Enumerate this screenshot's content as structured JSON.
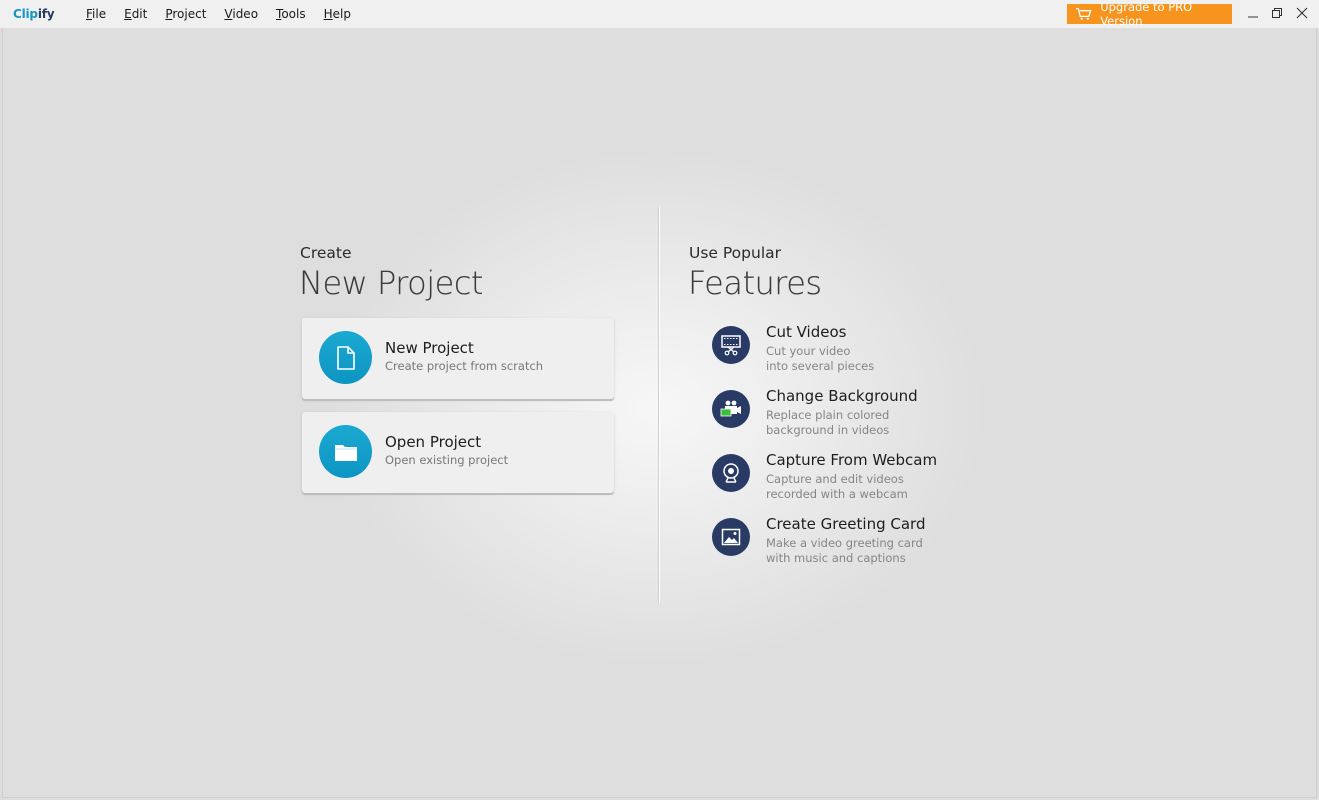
{
  "app": {
    "logo_part1": "Clip",
    "logo_part2": "ify"
  },
  "menu": [
    {
      "underlined": "F",
      "rest": "ile"
    },
    {
      "underlined": "E",
      "rest": "dit"
    },
    {
      "underlined": "P",
      "rest": "roject"
    },
    {
      "underlined": "V",
      "rest": "ideo"
    },
    {
      "underlined": "T",
      "rest": "ools"
    },
    {
      "underlined": "H",
      "rest": "elp"
    }
  ],
  "upgrade": {
    "label": "Upgrade to PRO Version",
    "icon": "cart-icon",
    "color": "#f7941d"
  },
  "window_controls": [
    "minimize-icon",
    "restore-icon",
    "close-icon"
  ],
  "create": {
    "small": "Create",
    "big": "New Project",
    "cards": [
      {
        "title": "New Project",
        "subtitle": "Create project from scratch",
        "icon": "document-icon"
      },
      {
        "title": "Open Project",
        "subtitle": "Open existing project",
        "icon": "folder-icon"
      }
    ],
    "accent": "#1ba9d1"
  },
  "features": {
    "small": "Use Popular",
    "big": "Features",
    "items": [
      {
        "title": "Cut Videos",
        "line1": "Cut your video",
        "line2": "into several pieces",
        "icon": "film-scissors-icon"
      },
      {
        "title": "Change Background",
        "line1": "Replace plain colored",
        "line2": "background in videos",
        "icon": "chroma-camera-icon"
      },
      {
        "title": "Capture From Webcam",
        "line1": "Capture and edit videos",
        "line2": "recorded with a webcam",
        "icon": "webcam-icon"
      },
      {
        "title": "Create Greeting Card",
        "line1": "Make a video greeting card",
        "line2": "with music and captions",
        "icon": "image-icon"
      }
    ],
    "icon_bg": "#293b64"
  }
}
